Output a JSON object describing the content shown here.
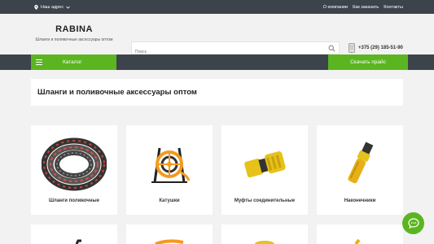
{
  "topbar": {
    "address_label": "Наш адрес",
    "links": [
      "О компании",
      "Как заказать",
      "Контакты"
    ]
  },
  "header": {
    "logo_name": "RABINA",
    "logo_tagline": "Шланги и поливочные аксессуары оптом",
    "search_placeholder": "Поиск",
    "phone": "+375 (29) 185-51-90"
  },
  "nav": {
    "catalog_label": "Каталог",
    "price_button": "Скачать прайс"
  },
  "main": {
    "title": "Шланги и поливочные аксессуары оптом",
    "categories": [
      {
        "label": "Шланги поливочные",
        "icon": "hose-icon"
      },
      {
        "label": "Катушки",
        "icon": "hose-reel-icon"
      },
      {
        "label": "Муфты соединительные",
        "icon": "connector-icon"
      },
      {
        "label": "Наконечники",
        "icon": "nozzle-icon"
      }
    ]
  },
  "colors": {
    "accent": "#5bb520",
    "dark": "#3d434b",
    "yellow": "#e6c21a",
    "orange": "#f39a1e"
  }
}
